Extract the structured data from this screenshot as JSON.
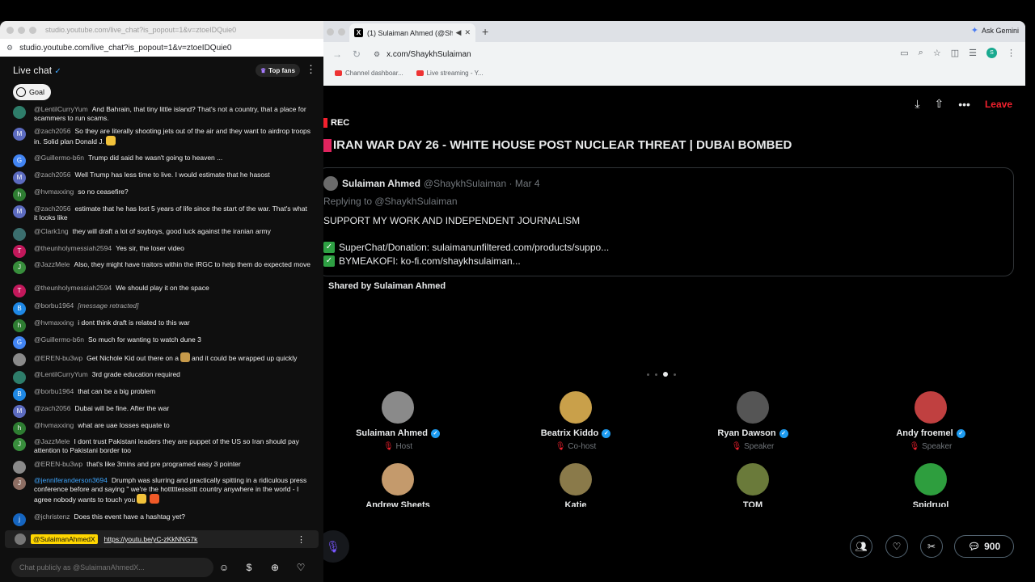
{
  "youtube_window": {
    "title_url": "studio.youtube.com/live_chat?is_popout=1&v=ztoeIDQuie0",
    "address": "studio.youtube.com/live_chat?is_popout=1&v=ztoeIDQuie0",
    "chat_label": "Live chat",
    "top_fans_label": "Top fans",
    "goal_label": "Goal",
    "messages": [
      {
        "initial": "",
        "color": "#2e7d6a",
        "author": "@LentilCurryYum",
        "text": "And Bahrain, that tiny little island? That's not a country, that a place for scammers to run scams."
      },
      {
        "initial": "M",
        "color": "#5c6bc0",
        "author": "@zach2056",
        "text": "So they are literally shooting jets out of the air and they want to airdrop troops in. Solid plan Donald J."
      },
      {
        "initial": "G",
        "color": "#4285f4",
        "author": "@Guillermo-b6n",
        "text": "Trump did said he wasn't going to heaven ..."
      },
      {
        "initial": "M",
        "color": "#5c6bc0",
        "author": "@zach2056",
        "text": "Well Trump has less time to live. I would estimate that he hasost"
      },
      {
        "initial": "h",
        "color": "#2e7d32",
        "author": "@hvmaxxing",
        "text": "so no ceasefire?"
      },
      {
        "initial": "M",
        "color": "#5c6bc0",
        "author": "@zach2056",
        "text": "estimate that he has lost 5 years of life since the start of the war. That's what it looks like"
      },
      {
        "initial": "",
        "color": "#3b6e6e",
        "author": "@Clark1ng",
        "text": "they will draft a lot of soyboys, good luck against the iranian army"
      },
      {
        "initial": "T",
        "color": "#c2185b",
        "author": "@theunholymessiah2594",
        "text": "Yes sir, the loser video"
      },
      {
        "initial": "J",
        "color": "#388e3c",
        "author": "@JazzMele",
        "text": "Also, they might have traitors within the IRGC to help them do expected move"
      },
      {
        "initial": "T",
        "color": "#c2185b",
        "author": "@theunholymessiah2594",
        "text": "We should play it on the space"
      },
      {
        "initial": "B",
        "color": "#1e88e5",
        "author": "@borbu1964",
        "text": "[message retracted]",
        "retracted": true
      },
      {
        "initial": "h",
        "color": "#2e7d32",
        "author": "@hvmaxxing",
        "text": "i dont think draft is related to this war"
      },
      {
        "initial": "G",
        "color": "#4285f4",
        "author": "@Guillermo-b6n",
        "text": "So much for wanting to watch dune 3"
      },
      {
        "initial": "",
        "color": "#8a8a8a",
        "author": "@EREN-bu3wp",
        "text": "Get Nichole Kid out there on a",
        "text2": "and it could be wrapped up quickly"
      },
      {
        "initial": "",
        "color": "#2e7d6a",
        "author": "@LentilCurryYum",
        "text": "3rd grade education required"
      },
      {
        "initial": "B",
        "color": "#1e88e5",
        "author": "@borbu1964",
        "text": "that can be a big problem"
      },
      {
        "initial": "M",
        "color": "#5c6bc0",
        "author": "@zach2056",
        "text": "Dubai will be fine. After the war"
      },
      {
        "initial": "h",
        "color": "#2e7d32",
        "author": "@hvmaxxing",
        "text": "what are uae losses equate to"
      },
      {
        "initial": "J",
        "color": "#388e3c",
        "author": "@JazzMele",
        "text": "I dont trust Pakistani leaders they are puppet of the US so Iran should pay attention to Pakistani border too"
      },
      {
        "initial": "",
        "color": "#8a8a8a",
        "author": "@EREN-bu3wp",
        "text": "that's like 3mins and pre programed easy 3 pointer"
      },
      {
        "initial": "J",
        "color": "#8d6e63",
        "author": "@jenniferanderson3694",
        "text": "Drumph was slurring and practically spitting in a ridiculous press conference before and saying \" we're the hotttttesssttt country anywhere in the world - I agree nobody wants to touch you",
        "moderator": true
      },
      {
        "initial": "j",
        "color": "#1565c0",
        "author": "@jchristenz",
        "text": "Does this event have a hashtag yet?"
      }
    ],
    "pinned": {
      "author": "@SulaimanAhmedX",
      "link": "https://youtu.be/yC-zKkNNG7k"
    },
    "input_placeholder": "Chat publicly as @SulaimanAhmedX..."
  },
  "x_window": {
    "tab_title": "(1) Sulaiman Ahmed (@Sh",
    "ask_gemini": "Ask Gemini",
    "address": "x.com/ShaykhSulaiman",
    "bookmarks": [
      "Channel dashboar...",
      "Live streaming - Y..."
    ],
    "leave_label": "Leave",
    "rec_label": "REC",
    "space_title": "IRAN WAR DAY 26 - WHITE HOUSE POST NUCLEAR THREAT | DUBAI BOMBED",
    "post": {
      "name": "Sulaiman Ahmed",
      "handle_date": "@ShaykhSulaiman · Mar 4",
      "replying": "Replying to @ShaykhSulaiman",
      "line1": "SUPPORT MY WORK AND INDEPENDENT JOURNALISM",
      "line2": "SuperChat/Donation: sulaimanunfiltered.com/products/suppo...",
      "line3": "BYMEAKOFI: ko-fi.com/shaykhsulaiman..."
    },
    "shared_by": "Shared by Sulaiman Ahmed",
    "speakers": [
      {
        "name": "Sulaiman Ahmed",
        "role": "Host",
        "color": "#8a8a8a"
      },
      {
        "name": "Beatrix Kiddo",
        "role": "Co-host",
        "color": "#c9a04a"
      },
      {
        "name": "Ryan Dawson",
        "role": "Speaker",
        "color": "#555555"
      },
      {
        "name": "Andy froemel",
        "role": "Speaker",
        "color": "#c04040"
      }
    ],
    "speakers_row2": [
      {
        "name": "Andrew Sheets",
        "color": "#c49a6c"
      },
      {
        "name": "Katie",
        "color": "#8a7a4a"
      },
      {
        "name": "TOM",
        "color": "#6a7a3a"
      },
      {
        "name": "Spidruol",
        "color": "#2e9e3e"
      }
    ],
    "listener_count": "900"
  }
}
